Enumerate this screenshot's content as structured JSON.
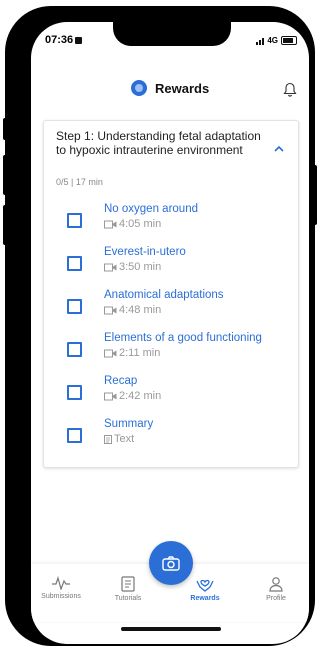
{
  "status": {
    "time": "07:36",
    "network": "4G"
  },
  "header": {
    "title": "Rewards"
  },
  "step": {
    "title": "Step 1: Understanding fetal adaptation to hypoxic intrauterine environment",
    "meta": "0/5 | 17 min"
  },
  "items": [
    {
      "title": "No oxygen around",
      "sub": "4:05 min",
      "icon": "video-icon"
    },
    {
      "title": "Everest-in-utero",
      "sub": "3:50 min",
      "icon": "video-icon"
    },
    {
      "title": "Anatomical adaptations",
      "sub": "4:48 min",
      "icon": "video-icon"
    },
    {
      "title": "Elements of a good functioning",
      "sub": "2:11 min",
      "icon": "video-icon"
    },
    {
      "title": "Recap",
      "sub": "2:42 min",
      "icon": "video-icon"
    },
    {
      "title": "Summary",
      "sub": "Text",
      "icon": "text-icon"
    }
  ],
  "nav": {
    "submissions": "Submissions",
    "tutorials": "Tutorials",
    "rewards": "Rewards",
    "profile": "Profile"
  },
  "colors": {
    "accent": "#2b6fd6"
  }
}
